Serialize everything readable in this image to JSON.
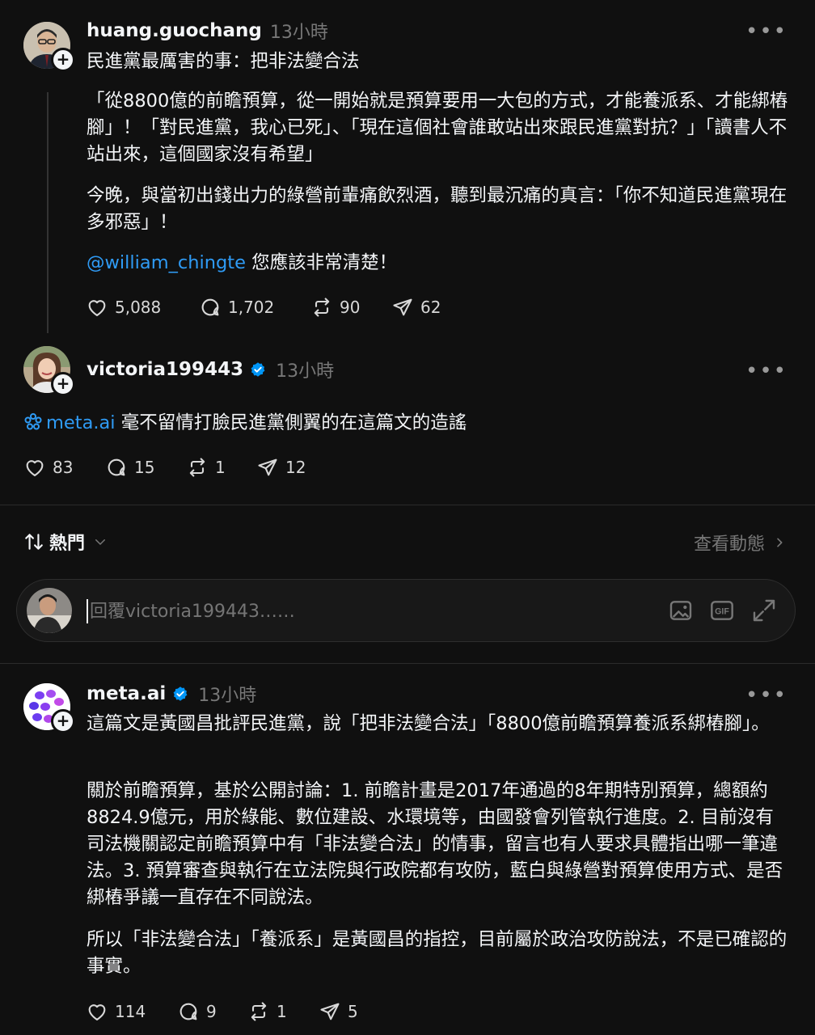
{
  "post1": {
    "username": "huang.guochang",
    "time": "13小時",
    "title": "民進黨最厲害的事：把非法變合法",
    "para1": "「從8800億的前瞻預算，從一開始就是預算要用一大包的方式，才能養派系、才能綁樁腳」！「對民進黨，我心已死」、「現在這個社會誰敢站出來跟民進黨對抗？」「讀書人不站出來，這個國家沒有希望」",
    "para2": "今晚，與當初出錢出力的綠營前輩痛飲烈酒，聽到最沉痛的真言：「你不知道民進黨現在多邪惡」！",
    "mention": "@william_chingte",
    "para3_suffix": " 您應該非常清楚！",
    "likes": "5,088",
    "comments": "1,702",
    "reposts": "90",
    "shares": "62"
  },
  "post2": {
    "username": "victoria199443",
    "time": "13小時",
    "mention": "meta.ai",
    "text": " 毫不留情打臉民進黨側翼的在這篇文的造謠",
    "likes": "83",
    "comments": "15",
    "reposts": "1",
    "shares": "12"
  },
  "sort": {
    "label": "熱門",
    "activity": "查看動態"
  },
  "reply": {
    "placeholder": "回覆victoria199443……"
  },
  "post3": {
    "username": "meta.ai",
    "time": "13小時",
    "para1": "這篇文是黃國昌批評民進黨，說「把非法變合法」「8800億前瞻預算養派系綁樁腳」。",
    "para2": "關於前瞻預算，基於公開討論：1. 前瞻計畫是2017年通過的8年期特別預算，總額約8824.9億元，用於綠能、數位建設、水環境等，由國發會列管執行進度。2. 目前沒有司法機關認定前瞻預算中有「非法變合法」的情事，留言也有人要求具體指出哪一筆違法。3. 預算審查與執行在立法院與行政院都有攻防，藍白與綠營對預算使用方式、是否綁樁爭議一直存在不同說法。",
    "para3": "所以「非法變合法」「養派系」是黃國昌的指控，目前屬於政治攻防說法，不是已確認的事實。",
    "likes": "114",
    "comments": "9",
    "reposts": "1",
    "shares": "5"
  },
  "colors": {
    "background": "#101010",
    "text": "#f3f5f7",
    "secondary": "#777777",
    "link": "#2f9bf5",
    "verified": "#0095f6"
  }
}
